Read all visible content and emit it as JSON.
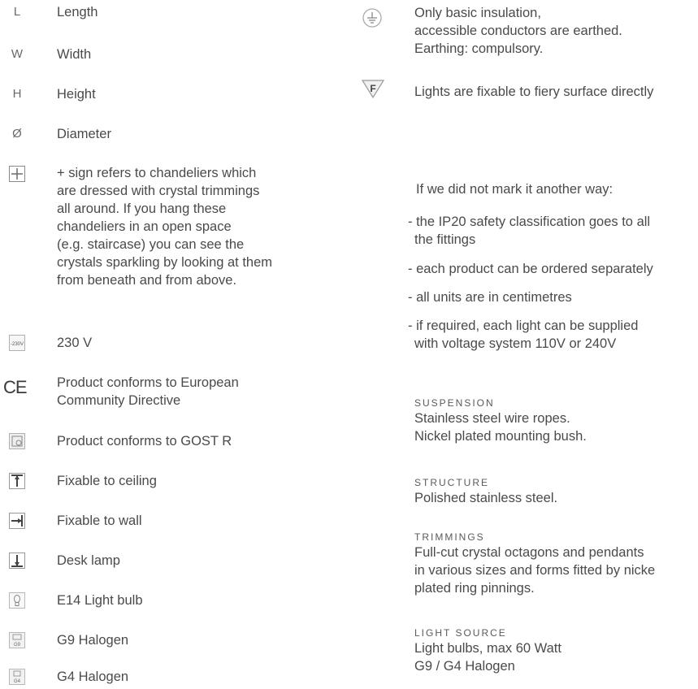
{
  "left_legend": {
    "items": [
      {
        "symbol": "L",
        "label": "Length"
      },
      {
        "symbol": "W",
        "label": "Width"
      },
      {
        "symbol": "H",
        "label": "Height"
      },
      {
        "symbol": "Ø",
        "label": "Diameter"
      }
    ],
    "plus_text": "+ sign refers to chandeliers which are dressed with crystal trimmings all around. If you hang these chandeliers in an open space (e.g. staircase) you can see the crystals sparkling by looking at them from beneath and from above.",
    "plus_lines": [
      "+ sign refers to chandeliers which",
      "are dressed with crystal trimmings",
      "all around. If you hang these",
      "chandeliers in an open space",
      "(e.g. staircase) you can see the",
      "crystals sparkling by looking at them",
      "from beneath and from above."
    ],
    "voltage_icon_text": "-230V",
    "voltage_label": "230 V",
    "ce_icon_text": "CE",
    "ce_lines": [
      "Product conforms to European",
      "Community Directive"
    ],
    "gost_label": "Product conforms to GOST R",
    "ceiling_label": "Fixable to ceiling",
    "wall_label": "Fixable to wall",
    "desk_label": "Desk lamp",
    "e14_label": "E14 Light bulb",
    "g9_icon_text": "G9",
    "g9_label": "G9 Halogen",
    "g4_icon_text": "G4",
    "g4_label": "G4 Halogen"
  },
  "right_panel": {
    "earth_lines": [
      "Only basic insulation,",
      "accessible conductors are earthed.",
      "Earthing: compulsory."
    ],
    "fiery_icon_text": "F",
    "fiery_label": "Lights are fixable to fiery surface directly",
    "notes_intro": "If we did not mark it another way:",
    "notes": [
      [
        "- the IP20 safety classification goes to all",
        "  the fittings"
      ],
      [
        "- each product can be ordered separately"
      ],
      [
        "- all units are in centimetres"
      ],
      [
        "- if required, each light can be supplied",
        "  with voltage system 110V or 240V"
      ]
    ],
    "specs": [
      {
        "title": "SUSPENSION",
        "lines": [
          "Stainless steel wire ropes.",
          "Nickel plated mounting bush."
        ]
      },
      {
        "title": "STRUCTURE",
        "lines": [
          "Polished stainless steel."
        ]
      },
      {
        "title": "TRIMMINGS",
        "lines": [
          "Full-cut crystal octagons and pendants",
          "in various sizes and forms fitted by nicke",
          "plated ring pinnings."
        ]
      },
      {
        "title": "LIGHT SOURCE",
        "lines": [
          "Light bulbs, max 60 Watt",
          "G9 / G4 Halogen"
        ]
      }
    ]
  }
}
